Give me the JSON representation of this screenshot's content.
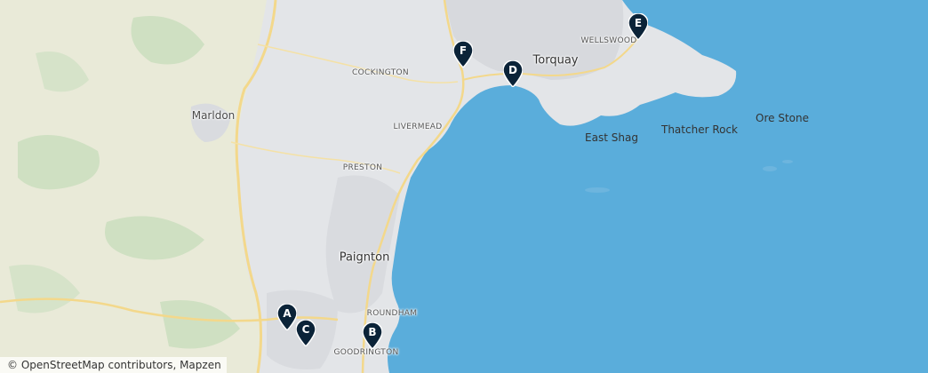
{
  "map": {
    "places": [
      {
        "id": "torquay",
        "label": "Torquay",
        "kind": "town"
      },
      {
        "id": "paignton",
        "label": "Paignton",
        "kind": "town"
      },
      {
        "id": "marldon",
        "label": "Marldon",
        "kind": "village"
      },
      {
        "id": "cockington",
        "label": "COCKINGTON",
        "kind": "suburb"
      },
      {
        "id": "livermead",
        "label": "LIVERMEAD",
        "kind": "suburb"
      },
      {
        "id": "preston",
        "label": "PRESTON",
        "kind": "suburb"
      },
      {
        "id": "roundham",
        "label": "ROUNDHAM",
        "kind": "suburb"
      },
      {
        "id": "goodrington",
        "label": "GOODRINGTON",
        "kind": "suburb"
      },
      {
        "id": "wellswood",
        "label": "WELLSWOOD",
        "kind": "suburb"
      },
      {
        "id": "east_shag",
        "label": "East Shag",
        "kind": "feature"
      },
      {
        "id": "thatcher_rock",
        "label": "Thatcher Rock",
        "kind": "feature"
      },
      {
        "id": "ore_stone",
        "label": "Ore Stone",
        "kind": "feature"
      }
    ],
    "markers": [
      {
        "id": "A",
        "label": "A"
      },
      {
        "id": "B",
        "label": "B"
      },
      {
        "id": "C",
        "label": "C"
      },
      {
        "id": "D",
        "label": "D"
      },
      {
        "id": "E",
        "label": "E"
      },
      {
        "id": "F",
        "label": "F"
      }
    ],
    "marker_color": "#0b2338",
    "sea_color": "#5aaddb",
    "land_color": "#e7e8ea",
    "attribution": "© OpenStreetMap contributors, Mapzen"
  }
}
